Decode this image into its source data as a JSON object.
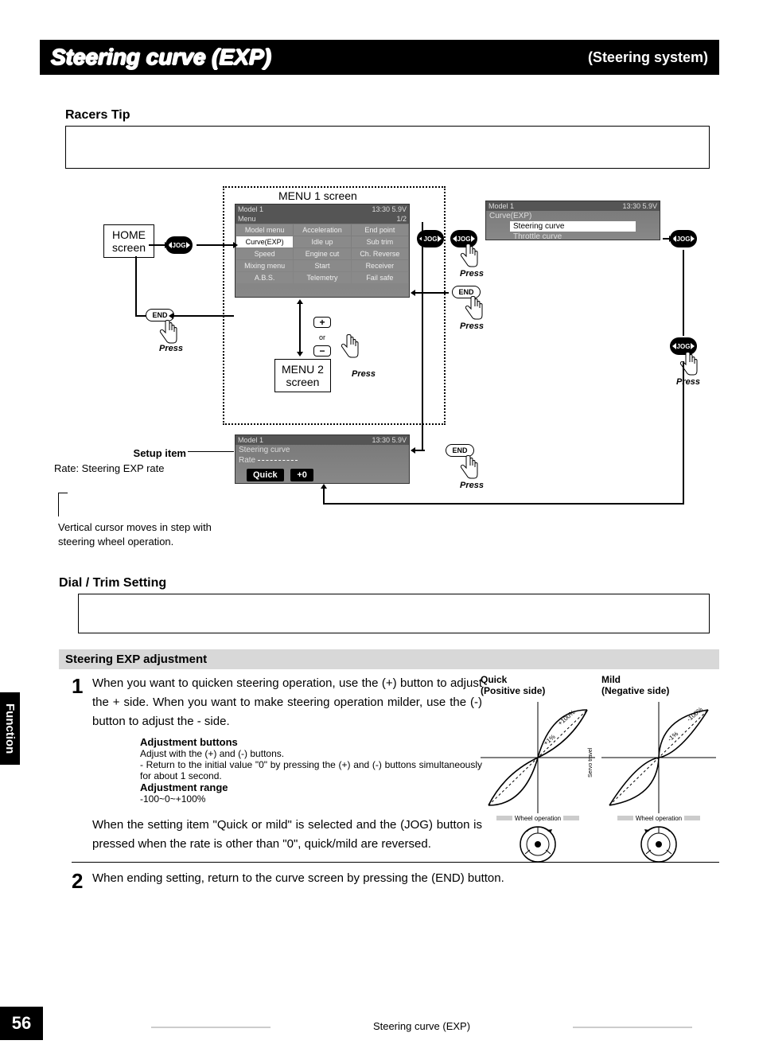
{
  "header": {
    "title": "Steering curve (EXP)",
    "subtitle": "(Steering system)"
  },
  "racers_tip_label": "Racers Tip",
  "diagram": {
    "home_screen": "HOME\nscreen",
    "menu1_label": "MENU 1 screen",
    "menu2_label": "MENU 2\nscreen",
    "setup_item_label": "Setup item",
    "rate_label": "Rate: Steering EXP rate",
    "cursor_note": "Vertical cursor moves in step with steering wheel operation.",
    "press": "Press",
    "or": "or",
    "jog": "JOG",
    "end": "END",
    "lcd_menu1": {
      "top_left": "Model 1",
      "top_right": "13:30 5.9V",
      "row2_left": "Menu",
      "row2_right": "1/2",
      "cells": [
        "Model menu",
        "Acceleration",
        "End point",
        "Curve(EXP)",
        "Idle up",
        "Sub trim",
        "Speed",
        "Engine cut",
        "Ch. Reverse",
        "Mixing menu",
        "Start",
        "Receiver",
        "A.B.S.",
        "Telemetry",
        "Fail safe"
      ]
    },
    "lcd_menu2": {
      "top_left": "Model 1",
      "top_right": "13:30 5.9V",
      "row2": "Curve(EXP)",
      "item1": "Steering curve",
      "item2": "Throttle curve"
    },
    "lcd_setup": {
      "top_left": "Model 1",
      "top_right": "13:30 5.9V",
      "row2": "Steering curve",
      "rate": "Rate",
      "quick": "Quick",
      "value": "+0"
    }
  },
  "dial_trim_label": "Dial / Trim Setting",
  "exp_adj_header": "Steering EXP adjustment",
  "step1": {
    "num": "1",
    "text": "When you want to quicken steering operation, use the (+) button to adjust the + side. When you want to make steering operation milder, use the (-) button to adjust the - side.",
    "adj_btn_h": "Adjustment buttons",
    "adj_btn_p1": "Adjust with the (+) and (-) buttons.",
    "adj_btn_p2": "- Return to the initial value \"0\" by pressing the (+) and (-) buttons simultaneously for about 1 second.",
    "adj_range_h": "Adjustment range",
    "adj_range_p": "-100~0~+100%",
    "quick_note": "When the setting item \"Quick or mild\" is selected and the (JOG) button is pressed when the rate is other than \"0\", quick/mild are reversed."
  },
  "step2": {
    "num": "2",
    "text": "When ending setting, return to the curve screen by pressing the (END) button."
  },
  "curves": {
    "quick_title": "Quick",
    "quick_sub": "(Positive side)",
    "mild_title": "Mild",
    "mild_sub": "(Negative side)",
    "servo_travel": "Servo travel",
    "wheel_op": "Wheel operation",
    "pct_low": "-1%",
    "pct_low_neg": "-100%",
    "pct_high": "+100%"
  },
  "side_tab": "Function",
  "page_number": "56",
  "footer": "Steering curve (EXP)"
}
